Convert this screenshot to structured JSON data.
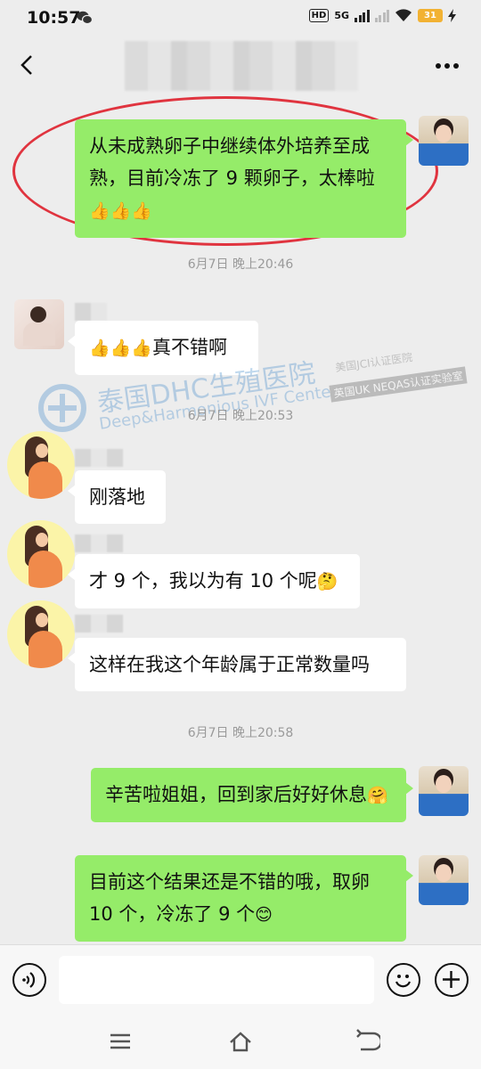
{
  "status_bar": {
    "time": "10:57",
    "hd_label": "HD",
    "network": "5G",
    "battery": "31"
  },
  "chat": {
    "messages": [
      {
        "side": "right",
        "text": "从未成熟卵子中继续体外培养至成熟，目前冷冻了 9 颗卵子，太棒啦",
        "emoji": "👍👍👍"
      },
      {
        "side": "left",
        "emoji": "👍👍👍",
        "text": "真不错啊"
      },
      {
        "side": "left",
        "text": "刚落地"
      },
      {
        "side": "left",
        "text": "才 9 个，我以为有 10 个呢",
        "emoji": "🤔"
      },
      {
        "side": "left",
        "text": "这样在我这个年龄属于正常数量吗"
      },
      {
        "side": "right",
        "text": "辛苦啦姐姐，回到家后好好休息",
        "emoji": "🤗"
      },
      {
        "side": "right",
        "text": "目前这个结果还是不错的哦，取卵 10 个，冷冻了 9 个",
        "emoji": "😊"
      }
    ],
    "timestamps": [
      "6月7日 晚上20:46",
      "6月7日 晚上20:53",
      "6月7日 晚上20:58"
    ]
  },
  "watermark": {
    "title": "泰国DHC生殖医院",
    "subtitle": "Deep&Harmonious IVF Center",
    "badge1": "美国JCI认证医院",
    "badge2": "英国UK NEQAS认证实验室",
    "badge_logo": "UK NEQAS"
  },
  "colors": {
    "bubble_right": "#95ec69",
    "bubble_left": "#ffffff",
    "background": "#ededed",
    "highlight_oval": "#e0343f"
  }
}
